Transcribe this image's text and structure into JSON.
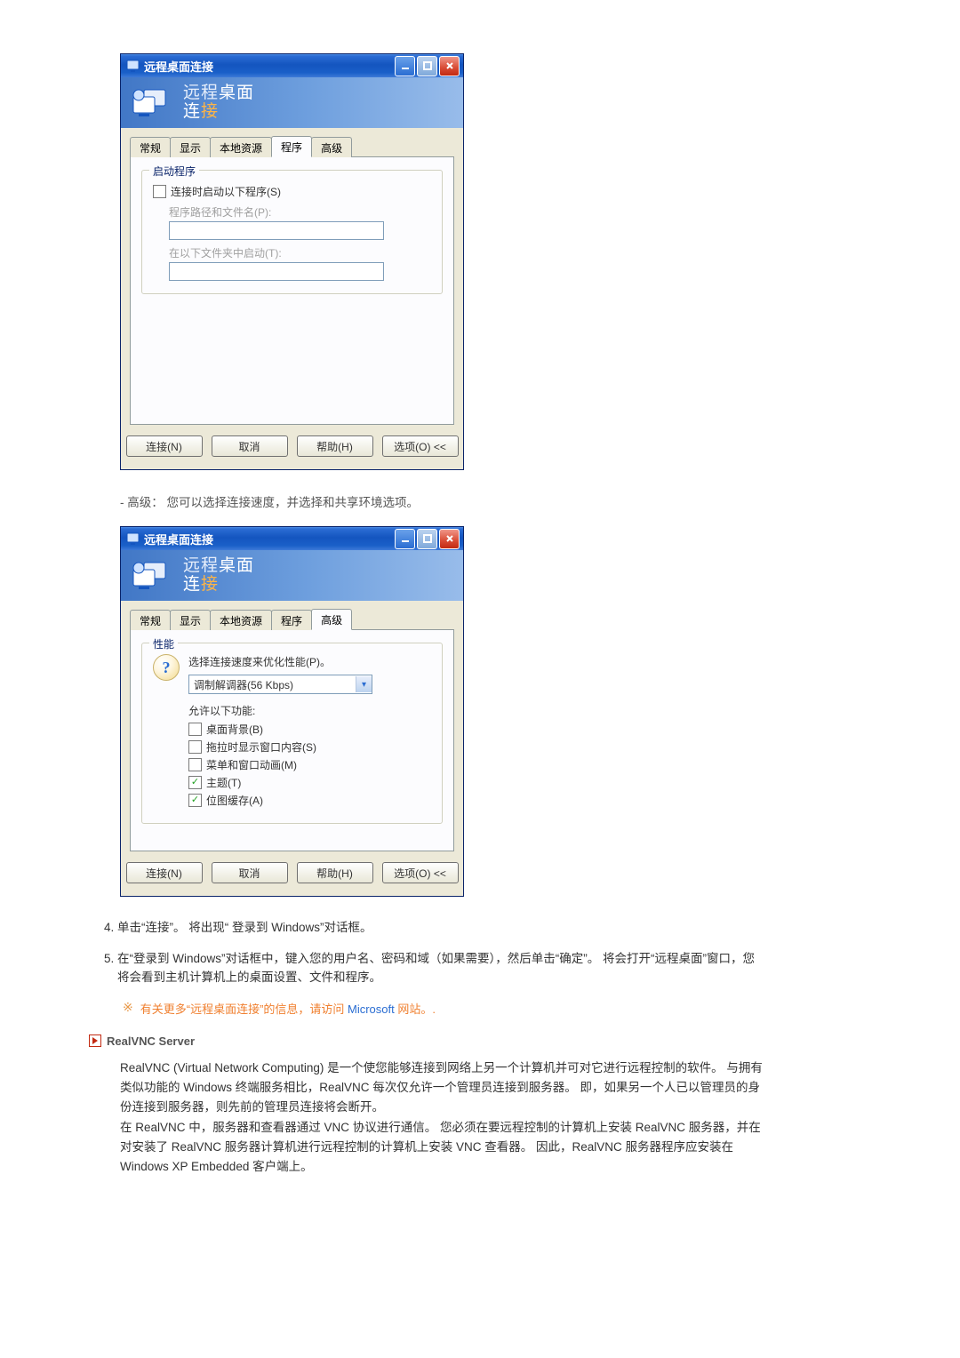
{
  "window_title": "远程桌面连接",
  "banner": {
    "line1a": "远程",
    "line1b": "桌面",
    "line2a": "连",
    "line2b": "接"
  },
  "tabs": {
    "general": "常规",
    "display": "显示",
    "local": "本地资源",
    "programs": "程序",
    "advanced": "高级"
  },
  "prog": {
    "group_legend": "启动程序",
    "checkbox": "连接时启动以下程序(S)",
    "path_label": "程序路径和文件名(P):",
    "folder_label": "在以下文件夹中启动(T):"
  },
  "buttons": {
    "connect": "连接(N)",
    "cancel": "取消",
    "help": "帮助(H)",
    "options": "选项(O) <<"
  },
  "mid_bullet": "- 高级：   您可以选择连接速度，并选择和共享环境选项。",
  "adv": {
    "group_legend": "性能",
    "instruction": "选择连接速度来优化性能(P)。",
    "combo_value": "调制解调器(56 Kbps)",
    "allow_label": "允许以下功能:",
    "opts": {
      "bg": {
        "checked": false,
        "label": "桌面背景(B)"
      },
      "drag": {
        "checked": false,
        "label": "拖拉时显示窗口内容(S)"
      },
      "anim": {
        "checked": false,
        "label": "菜单和窗口动画(M)"
      },
      "theme": {
        "checked": true,
        "label": "主题(T)"
      },
      "cache": {
        "checked": true,
        "label": "位图缓存(A)"
      }
    }
  },
  "steps": {
    "s4": "单击“连接”。 将出现“ 登录到 Windows”对话框。",
    "s5": "在“登录到 Windows”对话框中，键入您的用户名、密码和域（如果需要），然后单击“确定”。 将会打开“远程桌面”窗口，您将会看到主机计算机上的桌面设置、文件和程序。"
  },
  "note": {
    "text_before": "有关更多“远程桌面连接”的信息，请访问 ",
    "link": "Microsoft",
    "text_after": " 网站。."
  },
  "section2_title": "RealVNC Server",
  "para": "RealVNC (Virtual Network Computing) 是一个使您能够连接到网络上另一个计算机并可对它进行远程控制的软件。 与拥有类似功能的 Windows 终端服务相比，RealVNC 每次仅允许一个管理员连接到服务器。 即，如果另一个人已以管理员的身份连接到服务器，则先前的管理员连接将会断开。\n在 RealVNC 中，服务器和查看器通过 VNC 协议进行通信。 您必须在要远程控制的计算机上安装 RealVNC 服务器，并在对安装了 RealVNC 服务器计算机进行远程控制的计算机上安装 VNC 查看器。 因此，RealVNC 服务器程序应安装在 Windows XP Embedded 客户端上。"
}
